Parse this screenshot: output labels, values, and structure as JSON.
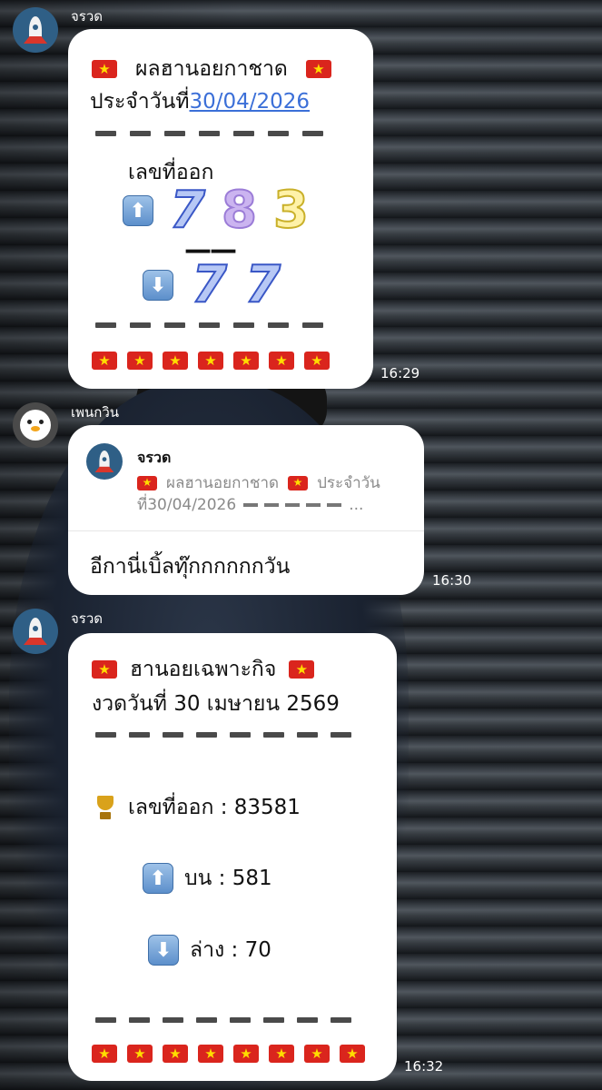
{
  "messages": [
    {
      "sender": "จรวด",
      "time": "16:29",
      "title": "ผลฮานอยกาชาด",
      "date_prefix": "ประจำวันที่",
      "date_link": "30/04/2026",
      "result_label": "เลขที่ออก",
      "top_digits": [
        "7",
        "8",
        "3"
      ],
      "separator": "——",
      "bottom_digits": [
        "7",
        "7"
      ],
      "up_icon": "⬆",
      "down_icon": "⬇"
    },
    {
      "sender": "เพนกวิน",
      "time": "16:30",
      "quote_sender": "จรวด",
      "quote_text_1": "ผลฮานอยกาชาด",
      "quote_text_2": "ประจำวัน",
      "quote_text_3": "ที่30/04/2026",
      "quote_ellipsis": "...",
      "reply_text": "อีกานี่เบิ้ลทุ๊กกกกกกวัน"
    },
    {
      "sender": "จรวด",
      "time": "16:32",
      "title": "ฮานอยเฉพาะกิจ",
      "subtitle": "งวดวันที่ 30 เมษายน 2569",
      "result_line": "เลขที่ออก : 83581",
      "top_line": "บน : 581",
      "bottom_line": "ล่าง : 70"
    }
  ],
  "colors": {
    "link": "#3b6fd8",
    "bubble": "#ffffff",
    "flag_red": "#da251d",
    "flag_star": "#ffdd00"
  }
}
